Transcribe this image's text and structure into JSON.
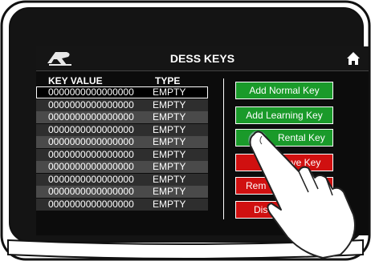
{
  "header": {
    "title": "DESS KEYS",
    "logo_icon": "r-logo-icon",
    "home_icon": "home-icon"
  },
  "table": {
    "columns": [
      "KEY VALUE",
      "TYPE"
    ],
    "rows": [
      {
        "key": "0000000000000000",
        "type": "EMPTY"
      },
      {
        "key": "0000000000000000",
        "type": "EMPTY"
      },
      {
        "key": "0000000000000000",
        "type": "EMPTY"
      },
      {
        "key": "0000000000000000",
        "type": "EMPTY"
      },
      {
        "key": "0000000000000000",
        "type": "EMPTY"
      },
      {
        "key": "0000000000000000",
        "type": "EMPTY"
      },
      {
        "key": "0000000000000000",
        "type": "EMPTY"
      },
      {
        "key": "0000000000000000",
        "type": "EMPTY"
      },
      {
        "key": "0000000000000000",
        "type": "EMPTY"
      },
      {
        "key": "0000000000000000",
        "type": "EMPTY"
      }
    ]
  },
  "buttons": {
    "add_normal": "Add Normal Key",
    "add_learning": "Add Learning Key",
    "add_rental_visible": "Rental Key",
    "remove_visible": "move Key",
    "remove_all_visible": "Rem",
    "disable_visible": "Dis"
  },
  "colors": {
    "green": "#1a9a2a",
    "red": "#d01010",
    "screen_bg": "#0c0c0c"
  }
}
